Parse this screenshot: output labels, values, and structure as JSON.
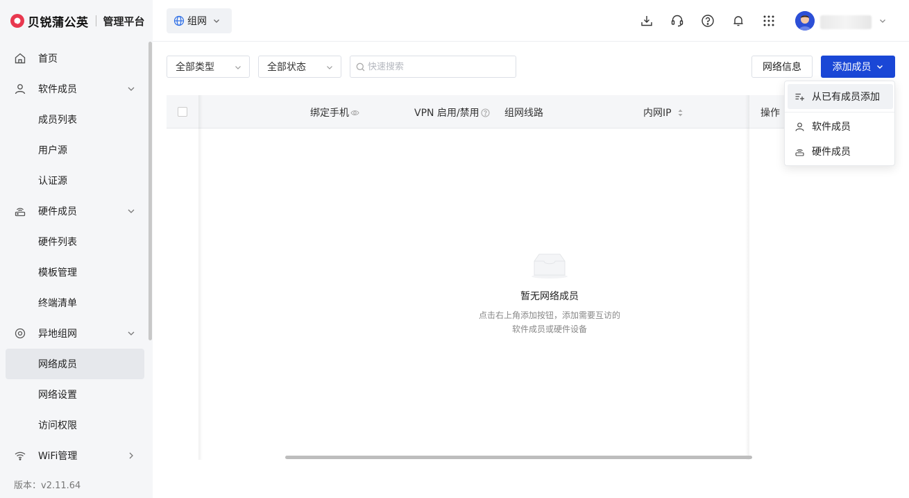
{
  "app": {
    "brand": "贝锐蒲公英",
    "subtitle": "管理平台"
  },
  "header": {
    "network_selector": "组网",
    "icons": [
      "download-icon",
      "headset-icon",
      "help-icon",
      "bell-icon",
      "apps-grid-icon"
    ]
  },
  "sidebar": {
    "items": [
      {
        "label": "首页",
        "icon": "home-icon"
      },
      {
        "label": "软件成员",
        "icon": "user-icon",
        "expanded": true
      },
      {
        "label": "成员列表"
      },
      {
        "label": "用户源"
      },
      {
        "label": "认证源"
      },
      {
        "label": "硬件成员",
        "icon": "router-icon",
        "expanded": true
      },
      {
        "label": "硬件列表"
      },
      {
        "label": "模板管理"
      },
      {
        "label": "终端清单"
      },
      {
        "label": "异地组网",
        "icon": "network-icon",
        "expanded": true
      },
      {
        "label": "网络成员",
        "active": true
      },
      {
        "label": "网络设置"
      },
      {
        "label": "访问权限"
      },
      {
        "label": "WiFi管理",
        "icon": "wifi-icon",
        "expanded": false
      }
    ],
    "version": "版本：v2.11.64"
  },
  "toolbar": {
    "type_filter": "全部类型",
    "status_filter": "全部状态",
    "search_placeholder": "快速搜索",
    "network_info_label": "网络信息",
    "add_member_label": "添加成员"
  },
  "table": {
    "columns": [
      "绑定手机",
      "VPN 启用/禁用",
      "组网线路",
      "内网IP",
      "操作"
    ]
  },
  "empty": {
    "title": "暂无网络成员",
    "desc_line1": "点击右上角添加按钮，添加需要互访的",
    "desc_line2": "软件成员或硬件设备"
  },
  "dropdown": {
    "items": [
      "从已有成员添加",
      "软件成员",
      "硬件成员"
    ]
  },
  "colors": {
    "primary": "#1a47d6",
    "accent_brand": "#e8384f"
  }
}
